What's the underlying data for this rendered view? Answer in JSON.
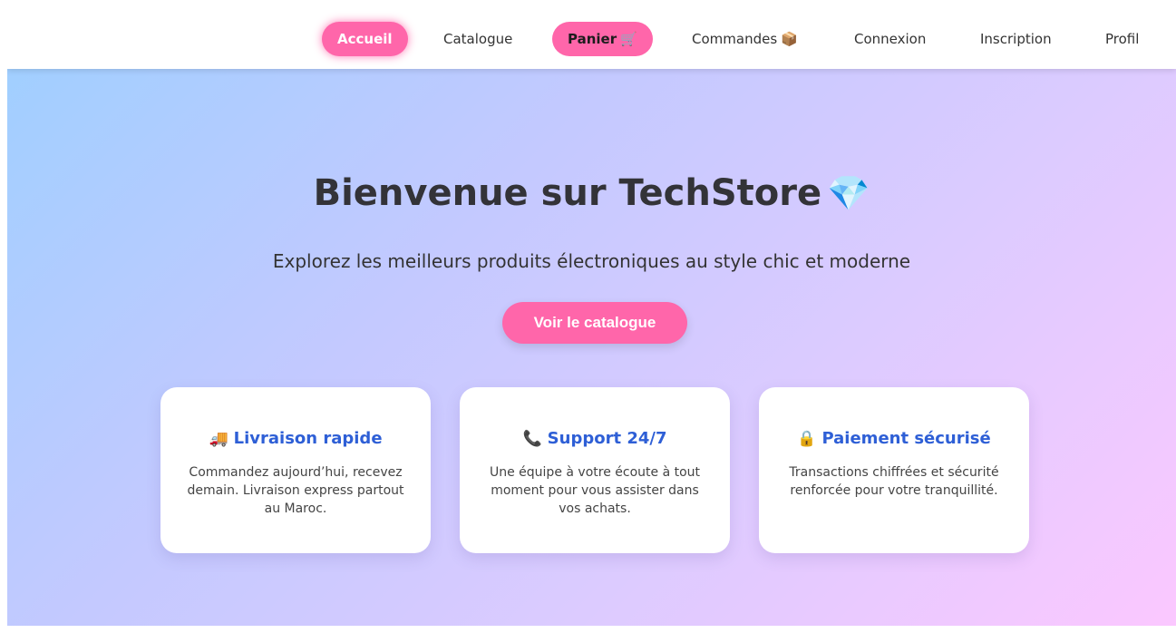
{
  "nav": {
    "items": [
      {
        "label": "Accueil",
        "emoji": ""
      },
      {
        "label": "Catalogue",
        "emoji": ""
      },
      {
        "label": "Panier",
        "emoji": "🛒"
      },
      {
        "label": "Commandes",
        "emoji": "📦"
      },
      {
        "label": "Connexion",
        "emoji": ""
      },
      {
        "label": "Inscription",
        "emoji": ""
      },
      {
        "label": "Profil",
        "emoji": ""
      }
    ],
    "active": "Accueil",
    "accent_color": "#ff66aa"
  },
  "hero": {
    "title": "Bienvenue sur TechStore",
    "title_emoji": "💎",
    "subtitle": "Explorez les meilleurs produits électroniques au style chic et moderne",
    "cta_label": "Voir le catalogue"
  },
  "features": [
    {
      "icon": "delivery-truck-icon",
      "emoji": "🚚",
      "title": "Livraison rapide",
      "text": "Commandez aujourd’hui, recevez demain. Livraison express partout au Maroc."
    },
    {
      "icon": "telephone-icon",
      "emoji": "📞",
      "title": "Support 24/7",
      "text": "Une équipe à votre écoute à tout moment pour vous assister dans vos achats."
    },
    {
      "icon": "lock-icon",
      "emoji": "🔒",
      "title": "Paiement sécurisé",
      "text": "Transactions chiffrées et sécurité renforcée pour votre tranquillité."
    }
  ],
  "colors": {
    "accent": "#ff66aa",
    "feature_title": "#2e5fd6",
    "gradient_start": "#a1cfff",
    "gradient_end": "#fbc8ff"
  }
}
